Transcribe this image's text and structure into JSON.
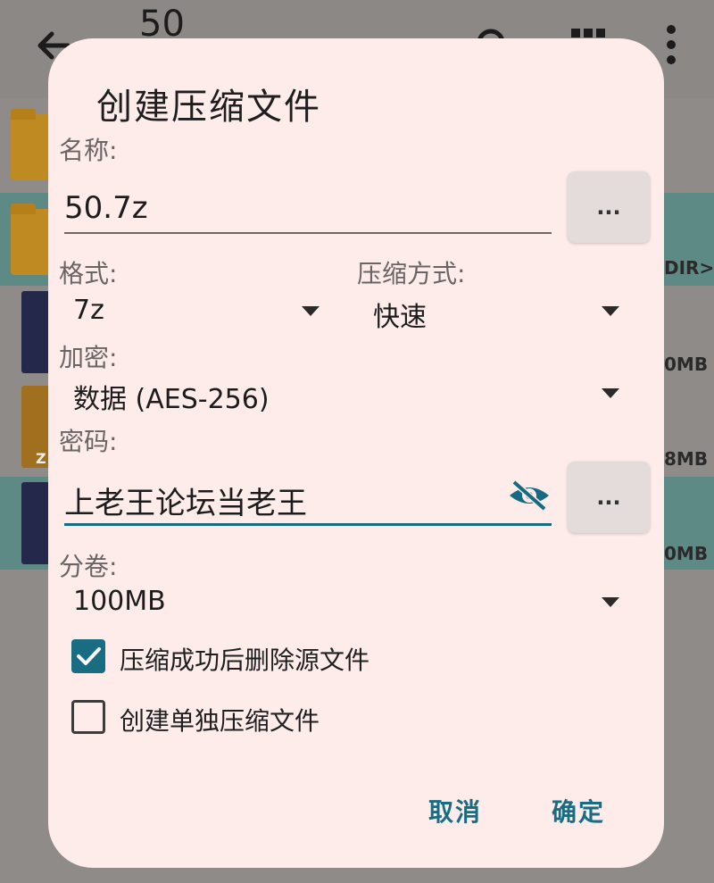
{
  "background": {
    "title": "50",
    "row_2_side": "DIR>",
    "row_3_side": "0MB",
    "row_4_side": "8MB",
    "row_4_file_letter": "Z",
    "row_5_side": "0MB"
  },
  "dialog": {
    "title": "创建压缩文件",
    "name": {
      "label": "名称:",
      "value": "50.7z",
      "button": "..."
    },
    "format": {
      "label": "格式:",
      "value": "7z"
    },
    "method": {
      "label": "压缩方式:",
      "value": "快速"
    },
    "encryption": {
      "label": "加密:",
      "value": "数据 (AES-256)"
    },
    "password": {
      "label": "密码:",
      "value": "上老王论坛当老王",
      "button": "..."
    },
    "volume": {
      "label": "分卷:",
      "value": "100MB"
    },
    "delete_source": {
      "label": "压缩成功后删除源文件",
      "checked": true
    },
    "separate_archives": {
      "label": "创建单独压缩文件",
      "checked": false
    },
    "cancel_label": "取消",
    "ok_label": "确定"
  },
  "colors": {
    "accent": "#196d83",
    "dialog_bg": "#fdecea"
  },
  "icons": [
    "back-arrow-icon",
    "search-icon",
    "grid-view-icon",
    "more-vert-icon",
    "visibility-off-icon",
    "dropdown-arrow-icon",
    "checkmark-icon"
  ]
}
